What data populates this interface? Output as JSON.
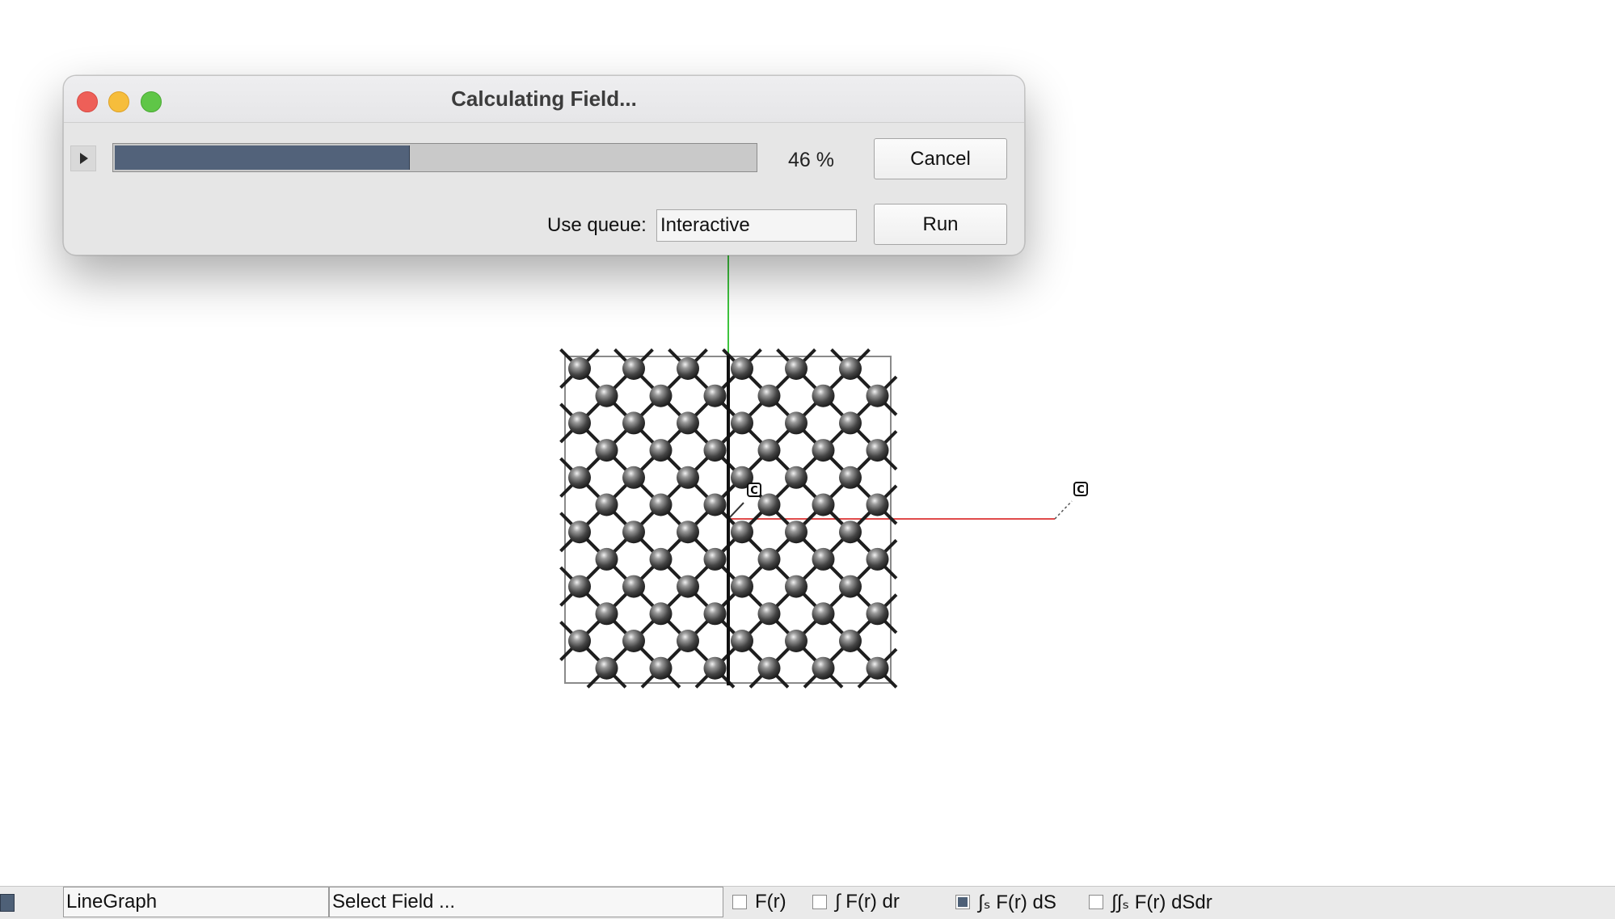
{
  "dialog": {
    "title": "Calculating Field...",
    "progress_percent": 46,
    "progress_text": "46 %",
    "cancel_label": "Cancel",
    "queue_label": "Use queue:",
    "queue_value": "Interactive",
    "run_label": "Run"
  },
  "viewer": {
    "atom_label": "C",
    "lattice_rows": 12,
    "lattice_cols": 12
  },
  "toolbar": {
    "graph_type": "LineGraph",
    "field_select": "Select Field ...",
    "options": [
      {
        "label": "F(r)",
        "checked": false
      },
      {
        "label": "∫ F(r) dr",
        "checked": false
      },
      {
        "label": "∫ₛ F(r) dS",
        "checked": true
      },
      {
        "label": "∫∫ₛ F(r) dSdr",
        "checked": false
      }
    ]
  },
  "colors": {
    "progress_fill": "#52627a",
    "axis_green": "#3ec43e",
    "axis_red": "#e04a4a",
    "atom": "#4a4a4a"
  }
}
